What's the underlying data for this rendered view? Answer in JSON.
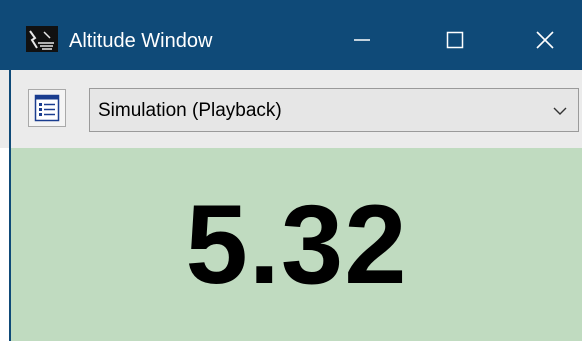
{
  "window": {
    "title": "Altitude Window",
    "controls": {
      "minimize_icon": "minimize-icon",
      "maximize_icon": "maximize-icon",
      "close_icon": "close-icon"
    }
  },
  "toolbar": {
    "list_icon": "list-icon",
    "source_select": {
      "value": "Simulation (Playback)",
      "icon": "chevron-down-icon"
    }
  },
  "display": {
    "altitude_value": "5.32",
    "background_color": "#c0dbc0"
  },
  "colors": {
    "titlebar": "#0f4a78",
    "toolbar": "#ebebeb"
  }
}
